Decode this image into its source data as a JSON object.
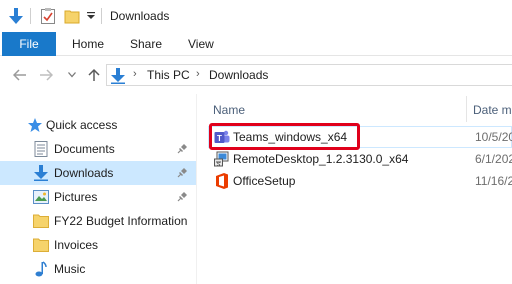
{
  "titlebar": {
    "title": "Downloads",
    "icons": [
      "down-arrow-icon",
      "properties-icon",
      "new-folder-icon",
      "customize-quick-access-icon"
    ]
  },
  "ribbon": {
    "tabs": [
      {
        "label": "File",
        "active": true
      },
      {
        "label": "Home"
      },
      {
        "label": "Share"
      },
      {
        "label": "View"
      }
    ]
  },
  "address": {
    "path": [
      "This PC",
      "Downloads"
    ],
    "nav_icons": [
      "back-icon",
      "forward-icon",
      "recent-locations-icon",
      "up-icon"
    ]
  },
  "sidebar": {
    "items": [
      {
        "label": "Quick access",
        "icon": "star-icon"
      },
      {
        "label": "Documents",
        "icon": "document-icon",
        "pinned": true
      },
      {
        "label": "Downloads",
        "icon": "download-icon",
        "pinned": true,
        "selected": true
      },
      {
        "label": "Pictures",
        "icon": "pictures-icon",
        "pinned": true
      },
      {
        "label": "FY22 Budget Information",
        "icon": "folder-icon"
      },
      {
        "label": "Invoices",
        "icon": "folder-icon"
      },
      {
        "label": "Music",
        "icon": "music-icon"
      }
    ]
  },
  "filelist": {
    "columns": {
      "name": "Name",
      "date": "Date m"
    },
    "files": [
      {
        "name": "Teams_windows_x64",
        "date": "10/5/20",
        "icon": "teams-icon",
        "highlighted": true
      },
      {
        "name": "RemoteDesktop_1.2.3130.0_x64",
        "date": "6/1/202",
        "icon": "installer-icon"
      },
      {
        "name": "OfficeSetup",
        "date": "11/16/2",
        "icon": "office-icon"
      }
    ]
  },
  "colors": {
    "accent": "#1979ca",
    "selection": "#cce8ff",
    "highlight_border": "#e0001b",
    "header_text": "#4c607a"
  }
}
